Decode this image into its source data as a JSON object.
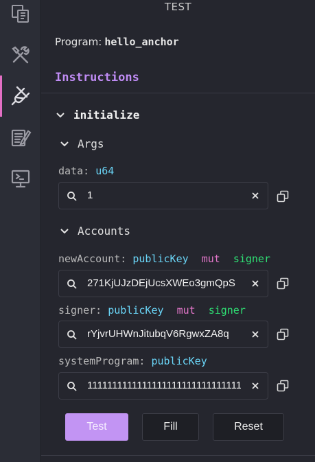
{
  "panel": {
    "title": "TEST"
  },
  "activity_bar": {
    "items": [
      {
        "icon": "files-icon",
        "active": false
      },
      {
        "icon": "tools-icon",
        "active": false
      },
      {
        "icon": "test-tube-icon",
        "active": true
      },
      {
        "icon": "notes-icon",
        "active": false
      },
      {
        "icon": "monitor-icon",
        "active": false
      }
    ],
    "accent_color": "#e36fc4"
  },
  "program": {
    "label": "Program:",
    "name": "hello_anchor"
  },
  "instructions": {
    "title": "Instructions",
    "items": [
      {
        "name": "initialize",
        "args": {
          "label": "Args",
          "fields": [
            {
              "name": "data:",
              "type": "u64",
              "value": "1"
            }
          ]
        },
        "accounts": {
          "label": "Accounts",
          "fields": [
            {
              "name": "newAccount:",
              "type": "publicKey",
              "mut": "mut",
              "signer": "signer",
              "value": "271KjUJzDEjUcsXWEo3gmQpS"
            },
            {
              "name": "signer:",
              "type": "publicKey",
              "mut": "mut",
              "signer": "signer",
              "value": "rYjvrUHWnJitubqV6RgwxZA8q"
            },
            {
              "name": "systemProgram:",
              "type": "publicKey",
              "value": "11111111111111111111111111111111"
            }
          ]
        }
      }
    ]
  },
  "buttons": {
    "test": "Test",
    "fill": "Fill",
    "reset": "Reset"
  },
  "colors": {
    "accent_purple": "#c08cf5",
    "type": "#6ad5f7",
    "mut": "#e276c9",
    "signer": "#2fe074",
    "test_button": "#c294f3"
  }
}
